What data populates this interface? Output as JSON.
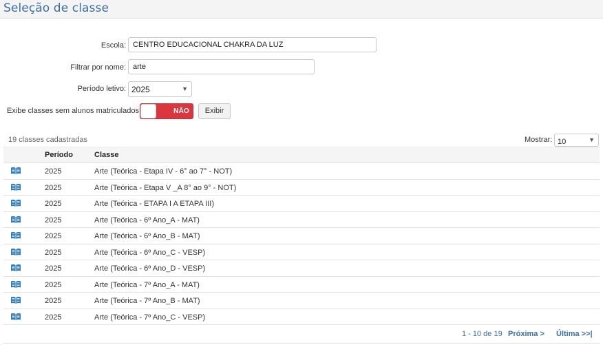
{
  "header": {
    "title": "Seleção de classe"
  },
  "form": {
    "escola_label": "Escola:",
    "escola_value": "CENTRO EDUCACIONAL CHAKRA DA LUZ",
    "filtro_label": "Filtrar por nome:",
    "filtro_value": "arte",
    "periodo_label": "Período letivo:",
    "periodo_value": "2025",
    "exibe_label": "Exibe classes sem alunos matriculados:",
    "toggle_text": "NÃO",
    "exibir_label": "Exibir"
  },
  "list": {
    "count_text": "19 classes cadastradas",
    "mostrar_label": "Mostrar:",
    "mostrar_value": "10",
    "headers": {
      "periodo": "Período",
      "classe": "Classe"
    },
    "rows": [
      {
        "periodo": "2025",
        "classe": "Arte (Teórica - Etapa IV - 6° ao 7° - NOT)"
      },
      {
        "periodo": "2025",
        "classe": "Arte (Teórica - Etapa V _A 8° ao 9° - NOT)"
      },
      {
        "periodo": "2025",
        "classe": "Arte (Teórica - ETAPA I A ETAPA III)"
      },
      {
        "periodo": "2025",
        "classe": "Arte (Teórica - 6º Ano_A - MAT)"
      },
      {
        "periodo": "2025",
        "classe": "Arte (Teórica - 6º Ano_B - MAT)"
      },
      {
        "periodo": "2025",
        "classe": "Arte (Teórica - 6º Ano_C - VESP)"
      },
      {
        "periodo": "2025",
        "classe": "Arte (Teórica - 6º Ano_D - VESP)"
      },
      {
        "periodo": "2025",
        "classe": "Arte (Teórica - 7º Ano_A - MAT)"
      },
      {
        "periodo": "2025",
        "classe": "Arte (Teórica - 7º Ano_B - MAT)"
      },
      {
        "periodo": "2025",
        "classe": "Arte (Teórica - 7º Ano_C - VESP)"
      }
    ]
  },
  "pager": {
    "info": "1 - 10 de 19",
    "next": "Próxima >",
    "last": "Última >>|"
  },
  "icons": {
    "row_icon": "open-book-icon",
    "select_caret": "caret-down-icon"
  },
  "colors": {
    "title": "#3a6fa6",
    "toggle_off": "#d9363e",
    "link": "#3a6fa6",
    "icon": "#2f7bbf"
  }
}
